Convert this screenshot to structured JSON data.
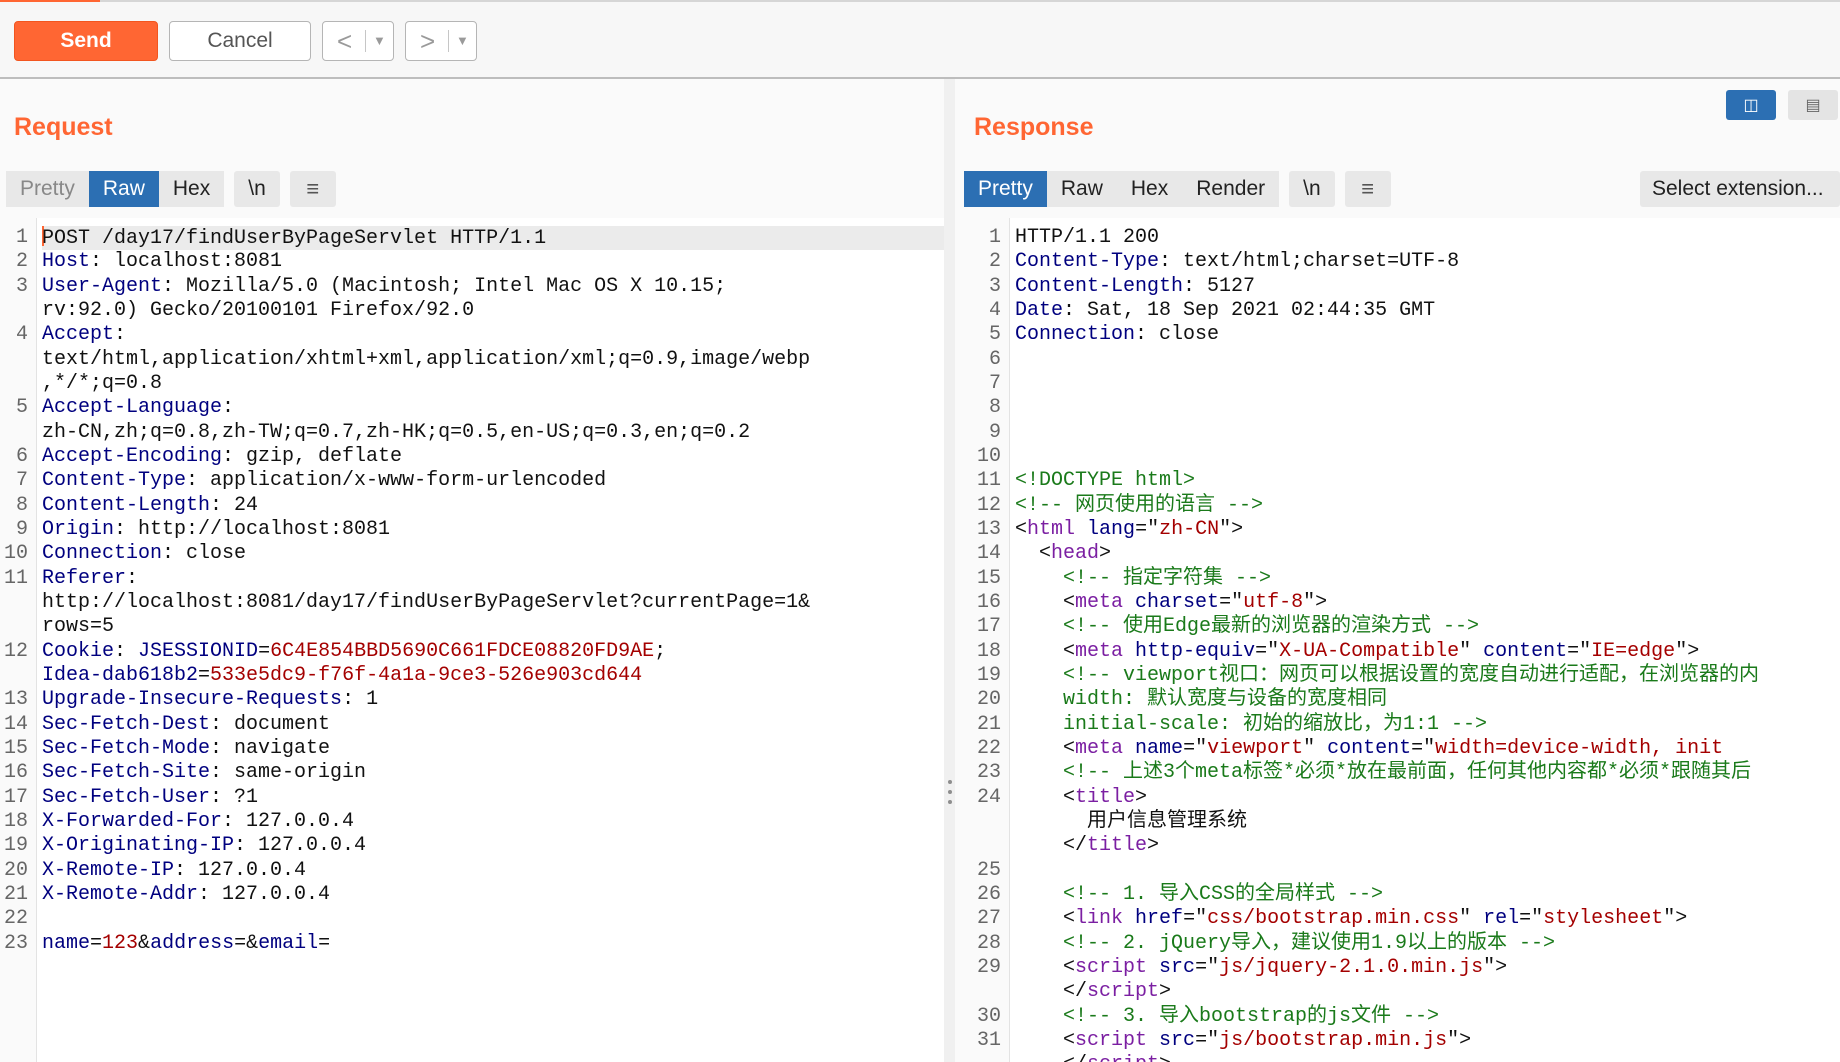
{
  "toolbar": {
    "send_label": "Send",
    "cancel_label": "Cancel",
    "back_glyph": "<",
    "forward_glyph": ">",
    "dropdown_glyph": "▼"
  },
  "request": {
    "title": "Request",
    "tabs": [
      "Pretty",
      "Raw",
      "Hex",
      "\\n"
    ],
    "active_tab": "Raw",
    "menu_icon": "hamburger-icon",
    "lines": [
      {
        "n": "1",
        "segs": [
          [
            "t",
            "POST /day17/findUserByPageServlet HTTP/1.1"
          ]
        ]
      },
      {
        "n": "2",
        "segs": [
          [
            "k",
            "Host"
          ],
          [
            "t",
            ": localhost:8081"
          ]
        ]
      },
      {
        "n": "3",
        "segs": [
          [
            "k",
            "User-Agent"
          ],
          [
            "t",
            ": Mozilla/5.0 (Macintosh; Intel Mac OS X 10.15;"
          ]
        ]
      },
      {
        "n": "",
        "segs": [
          [
            "t",
            "rv:92.0) Gecko/20100101 Firefox/92.0"
          ]
        ]
      },
      {
        "n": "4",
        "segs": [
          [
            "k",
            "Accept"
          ],
          [
            "t",
            ":"
          ]
        ]
      },
      {
        "n": "",
        "segs": [
          [
            "t",
            "text/html,application/xhtml+xml,application/xml;q=0.9,image/webp"
          ]
        ]
      },
      {
        "n": "",
        "segs": [
          [
            "t",
            ",*/*;q=0.8"
          ]
        ]
      },
      {
        "n": "5",
        "segs": [
          [
            "k",
            "Accept-Language"
          ],
          [
            "t",
            ":"
          ]
        ]
      },
      {
        "n": "",
        "segs": [
          [
            "t",
            "zh-CN,zh;q=0.8,zh-TW;q=0.7,zh-HK;q=0.5,en-US;q=0.3,en;q=0.2"
          ]
        ]
      },
      {
        "n": "6",
        "segs": [
          [
            "k",
            "Accept-Encoding"
          ],
          [
            "t",
            ": gzip, deflate"
          ]
        ]
      },
      {
        "n": "7",
        "segs": [
          [
            "k",
            "Content-Type"
          ],
          [
            "t",
            ": application/x-www-form-urlencoded"
          ]
        ]
      },
      {
        "n": "8",
        "segs": [
          [
            "k",
            "Content-Length"
          ],
          [
            "t",
            ": 24"
          ]
        ]
      },
      {
        "n": "9",
        "segs": [
          [
            "k",
            "Origin"
          ],
          [
            "t",
            ": http://localhost:8081"
          ]
        ]
      },
      {
        "n": "10",
        "segs": [
          [
            "k",
            "Connection"
          ],
          [
            "t",
            ": close"
          ]
        ]
      },
      {
        "n": "11",
        "segs": [
          [
            "k",
            "Referer"
          ],
          [
            "t",
            ":"
          ]
        ]
      },
      {
        "n": "",
        "segs": [
          [
            "t",
            "http://localhost:8081/day17/findUserByPageServlet?currentPage=1&"
          ]
        ]
      },
      {
        "n": "",
        "segs": [
          [
            "t",
            "rows=5"
          ]
        ]
      },
      {
        "n": "12",
        "segs": [
          [
            "k",
            "Cookie"
          ],
          [
            "t",
            ": "
          ],
          [
            "k",
            "JSESSIONID"
          ],
          [
            "t",
            "="
          ],
          [
            "v",
            "6C4E854BBD5690C661FDCE08820FD9AE"
          ],
          [
            "t",
            ";"
          ]
        ]
      },
      {
        "n": "",
        "segs": [
          [
            "k",
            "Idea-dab618b2"
          ],
          [
            "t",
            "="
          ],
          [
            "v",
            "533e5dc9-f76f-4a1a-9ce3-526e903cd644"
          ]
        ]
      },
      {
        "n": "13",
        "segs": [
          [
            "k",
            "Upgrade-Insecure-Requests"
          ],
          [
            "t",
            ": 1"
          ]
        ]
      },
      {
        "n": "14",
        "segs": [
          [
            "k",
            "Sec-Fetch-Dest"
          ],
          [
            "t",
            ": document"
          ]
        ]
      },
      {
        "n": "15",
        "segs": [
          [
            "k",
            "Sec-Fetch-Mode"
          ],
          [
            "t",
            ": navigate"
          ]
        ]
      },
      {
        "n": "16",
        "segs": [
          [
            "k",
            "Sec-Fetch-Site"
          ],
          [
            "t",
            ": same-origin"
          ]
        ]
      },
      {
        "n": "17",
        "segs": [
          [
            "k",
            "Sec-Fetch-User"
          ],
          [
            "t",
            ": ?1"
          ]
        ]
      },
      {
        "n": "18",
        "segs": [
          [
            "k",
            "X-Forwarded-For"
          ],
          [
            "t",
            ": 127.0.0.4"
          ]
        ]
      },
      {
        "n": "19",
        "segs": [
          [
            "k",
            "X-Originating-IP"
          ],
          [
            "t",
            ": 127.0.0.4"
          ]
        ]
      },
      {
        "n": "20",
        "segs": [
          [
            "k",
            "X-Remote-IP"
          ],
          [
            "t",
            ": 127.0.0.4"
          ]
        ]
      },
      {
        "n": "21",
        "segs": [
          [
            "k",
            "X-Remote-Addr"
          ],
          [
            "t",
            ": 127.0.0.4"
          ]
        ]
      },
      {
        "n": "22",
        "segs": []
      },
      {
        "n": "23",
        "segs": [
          [
            "k",
            "name"
          ],
          [
            "t",
            "="
          ],
          [
            "v",
            "123"
          ],
          [
            "t",
            "&"
          ],
          [
            "k",
            "address"
          ],
          [
            "t",
            "=&"
          ],
          [
            "k",
            "email"
          ],
          [
            "t",
            "="
          ]
        ]
      }
    ]
  },
  "response": {
    "title": "Response",
    "tabs": [
      "Pretty",
      "Raw",
      "Hex",
      "Render",
      "\\n"
    ],
    "active_tab": "Pretty",
    "menu_icon": "hamburger-icon",
    "select_extension_label": "Select extension...",
    "lines": [
      {
        "n": "1",
        "segs": [
          [
            "t",
            "HTTP/1.1 200"
          ]
        ]
      },
      {
        "n": "2",
        "segs": [
          [
            "k",
            "Content-Type"
          ],
          [
            "t",
            ": text/html;charset=UTF-8"
          ]
        ]
      },
      {
        "n": "3",
        "segs": [
          [
            "k",
            "Content-Length"
          ],
          [
            "t",
            ": 5127"
          ]
        ]
      },
      {
        "n": "4",
        "segs": [
          [
            "k",
            "Date"
          ],
          [
            "t",
            ": Sat, 18 Sep 2021 02:44:35 GMT"
          ]
        ]
      },
      {
        "n": "5",
        "segs": [
          [
            "k",
            "Connection"
          ],
          [
            "t",
            ": close"
          ]
        ]
      },
      {
        "n": "6",
        "segs": []
      },
      {
        "n": "7",
        "segs": []
      },
      {
        "n": "8",
        "segs": []
      },
      {
        "n": "9",
        "segs": []
      },
      {
        "n": "10",
        "segs": []
      },
      {
        "n": "11",
        "segs": [
          [
            "cm",
            "<!DOCTYPE html>"
          ]
        ]
      },
      {
        "n": "12",
        "segs": [
          [
            "cm",
            "<!-- 网页使用的语言 -->"
          ]
        ]
      },
      {
        "n": "13",
        "segs": [
          [
            "t",
            "<"
          ],
          [
            "tg",
            "html"
          ],
          [
            "t",
            " "
          ],
          [
            "k",
            "lang"
          ],
          [
            "t",
            "=\""
          ],
          [
            "v",
            "zh-CN"
          ],
          [
            "t",
            "\">"
          ]
        ]
      },
      {
        "n": "14",
        "segs": [
          [
            "t",
            "  <"
          ],
          [
            "tg",
            "head"
          ],
          [
            "t",
            ">"
          ]
        ]
      },
      {
        "n": "15",
        "segs": [
          [
            "cm",
            "    <!-- 指定字符集 -->"
          ]
        ]
      },
      {
        "n": "16",
        "segs": [
          [
            "t",
            "    <"
          ],
          [
            "tg",
            "meta"
          ],
          [
            "t",
            " "
          ],
          [
            "k",
            "charset"
          ],
          [
            "t",
            "=\""
          ],
          [
            "v",
            "utf-8"
          ],
          [
            "t",
            "\">"
          ]
        ]
      },
      {
        "n": "17",
        "segs": [
          [
            "cm",
            "    <!-- 使用Edge最新的浏览器的渲染方式 -->"
          ]
        ]
      },
      {
        "n": "18",
        "segs": [
          [
            "t",
            "    <"
          ],
          [
            "tg",
            "meta"
          ],
          [
            "t",
            " "
          ],
          [
            "k",
            "http-equiv"
          ],
          [
            "t",
            "=\""
          ],
          [
            "v",
            "X-UA-Compatible"
          ],
          [
            "t",
            "\" "
          ],
          [
            "k",
            "content"
          ],
          [
            "t",
            "=\""
          ],
          [
            "v",
            "IE=edge"
          ],
          [
            "t",
            "\">"
          ]
        ]
      },
      {
        "n": "19",
        "segs": [
          [
            "cm",
            "    <!-- viewport视口：网页可以根据设置的宽度自动进行适配，在浏览器的内"
          ]
        ]
      },
      {
        "n": "20",
        "segs": [
          [
            "cm",
            "    width: 默认宽度与设备的宽度相同"
          ]
        ]
      },
      {
        "n": "21",
        "segs": [
          [
            "cm",
            "    initial-scale: 初始的缩放比，为1:1 -->"
          ]
        ]
      },
      {
        "n": "22",
        "segs": [
          [
            "t",
            "    <"
          ],
          [
            "tg",
            "meta"
          ],
          [
            "t",
            " "
          ],
          [
            "k",
            "name"
          ],
          [
            "t",
            "=\""
          ],
          [
            "v",
            "viewport"
          ],
          [
            "t",
            "\" "
          ],
          [
            "k",
            "content"
          ],
          [
            "t",
            "=\""
          ],
          [
            "v",
            "width=device-width, init"
          ]
        ]
      },
      {
        "n": "23",
        "segs": [
          [
            "cm",
            "    <!-- 上述3个meta标签*必须*放在最前面，任何其他内容都*必须*跟随其后"
          ]
        ]
      },
      {
        "n": "24",
        "segs": [
          [
            "t",
            "    <"
          ],
          [
            "tg",
            "title"
          ],
          [
            "t",
            ">"
          ]
        ]
      },
      {
        "n": "",
        "segs": [
          [
            "t",
            "      用户信息管理系统"
          ]
        ]
      },
      {
        "n": "",
        "segs": [
          [
            "t",
            "    </"
          ],
          [
            "tg",
            "title"
          ],
          [
            "t",
            ">"
          ]
        ]
      },
      {
        "n": "25",
        "segs": []
      },
      {
        "n": "26",
        "segs": [
          [
            "cm",
            "    <!-- 1. 导入CSS的全局样式 -->"
          ]
        ]
      },
      {
        "n": "27",
        "segs": [
          [
            "t",
            "    <"
          ],
          [
            "tg",
            "link"
          ],
          [
            "t",
            " "
          ],
          [
            "k",
            "href"
          ],
          [
            "t",
            "=\""
          ],
          [
            "v",
            "css/bootstrap.min.css"
          ],
          [
            "t",
            "\" "
          ],
          [
            "k",
            "rel"
          ],
          [
            "t",
            "=\""
          ],
          [
            "v",
            "stylesheet"
          ],
          [
            "t",
            "\">"
          ]
        ]
      },
      {
        "n": "28",
        "segs": [
          [
            "cm",
            "    <!-- 2. jQuery导入，建议使用1.9以上的版本 -->"
          ]
        ]
      },
      {
        "n": "29",
        "segs": [
          [
            "t",
            "    <"
          ],
          [
            "tg",
            "script"
          ],
          [
            "t",
            " "
          ],
          [
            "k",
            "src"
          ],
          [
            "t",
            "=\""
          ],
          [
            "v",
            "js/jquery-2.1.0.min.js"
          ],
          [
            "t",
            "\">"
          ]
        ]
      },
      {
        "n": "",
        "segs": [
          [
            "t",
            "    </"
          ],
          [
            "tg",
            "script"
          ],
          [
            "t",
            ">"
          ]
        ]
      },
      {
        "n": "30",
        "segs": [
          [
            "cm",
            "    <!-- 3. 导入bootstrap的js文件 -->"
          ]
        ]
      },
      {
        "n": "31",
        "segs": [
          [
            "t",
            "    <"
          ],
          [
            "tg",
            "script"
          ],
          [
            "t",
            " "
          ],
          [
            "k",
            "src"
          ],
          [
            "t",
            "=\""
          ],
          [
            "v",
            "js/bootstrap.min.js"
          ],
          [
            "t",
            "\">"
          ]
        ]
      },
      {
        "n": "",
        "segs": [
          [
            "t",
            "    </"
          ],
          [
            "tg",
            "script"
          ],
          [
            "t",
            ">"
          ]
        ]
      }
    ]
  },
  "colors": {
    "accent": "#ff6633",
    "tab_active": "#2c6fb3",
    "header_key": "#00007f",
    "value": "#a40000",
    "comment": "#1a7a1a",
    "tag": "#7b1fa2"
  }
}
